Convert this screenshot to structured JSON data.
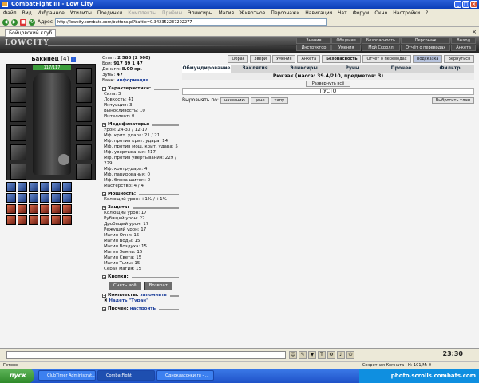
{
  "window": {
    "title": "CombatFight III - Low City"
  },
  "menu": {
    "items": [
      "Файл",
      "Вид",
      "Избранное",
      "Утилиты",
      "Поединки",
      "Комплекты",
      "Приёмы",
      "Эликсиры",
      "Магия",
      "Животное",
      "Персонажи",
      "Навигация",
      "Чат",
      "Форум",
      "Окно",
      "Настройки",
      "?"
    ]
  },
  "address": {
    "label": "Адрес",
    "url": "http://lowcity.combats.com/buttons.pl?battle=0.342352237202277",
    "tab_title": "Бойцовский клуб"
  },
  "game": {
    "logo": "LOWCITY",
    "top_menu": [
      "Знания",
      "Общение",
      "Безопасность",
      "Персонаж",
      "Выход",
      "Инструктор",
      "Умения",
      "Мой Скролл",
      "Отчёт о переводах",
      "Анкета"
    ]
  },
  "character": {
    "name": "Бакинец",
    "level": "[4]",
    "info_icon": "i",
    "hp": "117/117",
    "pet_name": "Питомец",
    "stats_top": [
      {
        "label": "Опыт:",
        "value": "2 588 (2 900)"
      },
      {
        "label": "Бои:",
        "value": "917 39 1 47"
      },
      {
        "label": "Деньги:",
        "value": "8.00 кр."
      },
      {
        "label": "Зубы:",
        "value": "47"
      }
    ],
    "bank_label": "Банк:",
    "bank_link": "информация",
    "sections": [
      {
        "title": "Характеристики:",
        "lines": [
          "Сила: 3",
          "Ловкость: 41",
          "Интуиция: 3",
          "Выносливость: 10",
          "Интеллект: 0"
        ]
      },
      {
        "title": "Модификаторы:",
        "lines": [
          "Урон: 24-33 / 12-17",
          "Мф. крит. удара: 21 / 21",
          "Мф. против крит. удара: 14",
          "Мф. против мощ. крит. удара: 5",
          "Мф. увертывания: 417",
          "Мф. против увертывания: 229 / 229",
          "Мф. контрудара: 4",
          "Мф. парирования: 0",
          "Мф. блока щитом: 0",
          "Мастерство: 4 / 4"
        ]
      },
      {
        "title": "Мощность:",
        "lines": [
          "Колющий урон: +1% / +1%"
        ]
      },
      {
        "title": "Защита:",
        "lines": [
          "Колющий урон: 17",
          "Рубящий урон: 22",
          "Дробящий урон: 17",
          "Режущий урон: 17",
          "Магия Огня: 15",
          "Магия Воды: 15",
          "Магия Воздуха: 15",
          "Магия Земли: 15",
          "Магия Света: 15",
          "Магия Тьмы: 15",
          "Серая магия: 15"
        ]
      }
    ],
    "buttons_section": "Кнопки:",
    "btn_remove_all": "Снять всё",
    "btn_return": "Возврат",
    "sets_section": "Комплекты:",
    "sets_link": "запомнить",
    "set_item": "Надеть \"Туран\"",
    "other_section": "Прочее:",
    "other_link": "настроить"
  },
  "inventory": {
    "top_buttons": [
      "Образ",
      "Звери",
      "Умения",
      "Анкета",
      "Безопасность",
      "Отчет о переводах",
      "Подсказка",
      "Вернуться"
    ],
    "active_top": "Подсказка",
    "tabs": [
      "Обмундирование",
      "Заклятия",
      "Эликсиры",
      "Руны",
      "Прочее",
      "Фильтр"
    ],
    "active_tab": "Обмундирование",
    "rucksack": "Рюкзак (масса: 39.4/210, предметов: 3)",
    "unpack": "Развернуть всё",
    "empty": "ПУСТО",
    "sort_label": "Выровнять по:",
    "sort_buttons": [
      "названию",
      "цене",
      "типу"
    ],
    "throw_button": "Выбросить хлам"
  },
  "bottom": {
    "clock": "23:30",
    "status_left": "Готово",
    "status_mid": "Секретная Комната",
    "status_right": "Н: 101/М: 0"
  },
  "taskbar": {
    "start": "пуск",
    "tasks": [
      "ClubTimer Administrat...",
      "CombatFight",
      "Однокласснки.ru - ..."
    ],
    "active_task": "CombatFight",
    "watermark": "photo.scrolls.combats.com"
  }
}
